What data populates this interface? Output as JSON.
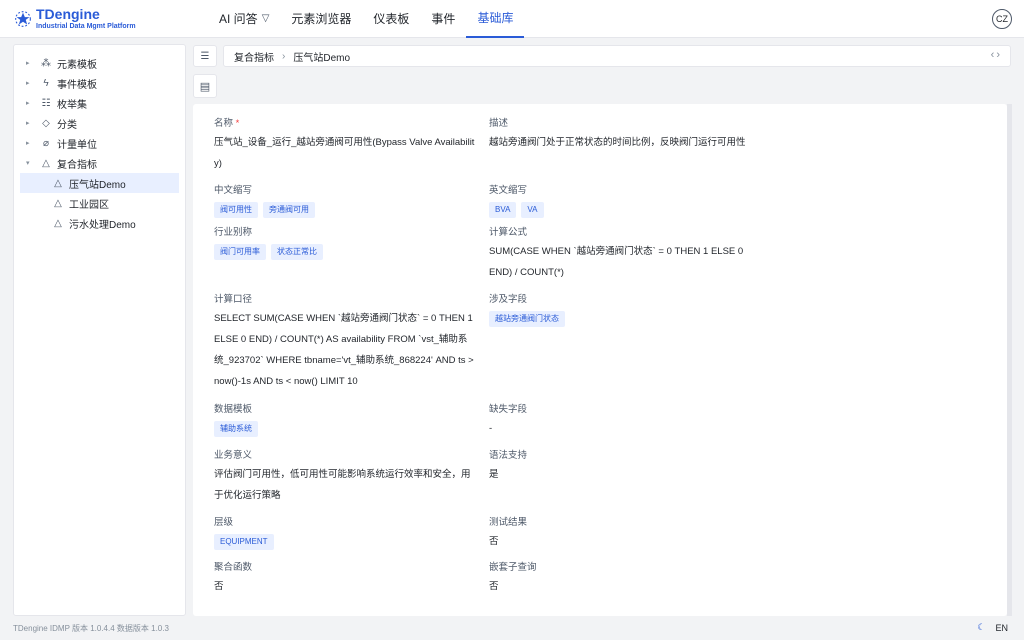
{
  "app": {
    "logo_title": "TDengine",
    "logo_subtitle": "Industrial Data Mgmt Platform",
    "avatar": "CZ"
  },
  "nav": {
    "items": [
      {
        "label": "AI 问答",
        "icon": "sparkle-icon"
      },
      {
        "label": "元素浏览器"
      },
      {
        "label": "仪表板"
      },
      {
        "label": "事件"
      },
      {
        "label": "基础库"
      }
    ],
    "active_index": 4
  },
  "sidebar": {
    "items": [
      {
        "label": "元素模板",
        "icon": "element-template-icon"
      },
      {
        "label": "事件模板",
        "icon": "lightning-icon"
      },
      {
        "label": "枚举集",
        "icon": "list-icon"
      },
      {
        "label": "分类",
        "icon": "tag-icon"
      },
      {
        "label": "计量单位",
        "icon": "ruler-icon"
      },
      {
        "label": "复合指标",
        "icon": "triangle-icon"
      }
    ],
    "children": [
      {
        "label": "压气站Demo",
        "selected": true
      },
      {
        "label": "工业园区"
      },
      {
        "label": "污水处理Demo"
      }
    ]
  },
  "breadcrumb": {
    "parent": "复合指标",
    "current": "压气站Demo"
  },
  "detail": {
    "name_label": "名称",
    "name_required_mark": "*",
    "name_value": "压气站_设备_运行_越站旁通阀可用性(Bypass Valve Availability)",
    "desc_label": "描述",
    "desc_value": "越站旁通阀门处于正常状态的时间比例，反映阀门运行可用性",
    "cn_abbr_label": "中文缩写",
    "cn_abbr_tags": [
      "阀可用性",
      "旁通阀可用"
    ],
    "en_abbr_label": "英文缩写",
    "en_abbr_tags": [
      "BVA",
      "VA"
    ],
    "alias_label": "行业别称",
    "alias_tags": [
      "阀门可用率",
      "状态正常比"
    ],
    "formula_label": "计算公式",
    "formula_value": "SUM(CASE WHEN `越站旁通阀门状态` = 0 THEN 1 ELSE 0 END) / COUNT(*)",
    "caliber_label": "计算口径",
    "caliber_value": "SELECT SUM(CASE WHEN `越站旁通阀门状态` = 0 THEN 1 ELSE 0 END) / COUNT(*) AS availability FROM `vst_辅助系统_923702` WHERE tbname='vt_辅助系统_868224' AND ts > now()-1s AND ts < now() LIMIT 10",
    "fields_label": "涉及字段",
    "fields_tags": [
      "越站旁通阀门状态"
    ],
    "template_label": "数据模板",
    "template_tags": [
      "辅助系统"
    ],
    "missing_label": "缺失字段",
    "missing_value": "-",
    "meaning_label": "业务意义",
    "meaning_value": "评估阀门可用性，低可用性可能影响系统运行效率和安全，用于优化运行策略",
    "syntax_label": "语法支持",
    "syntax_value": "是",
    "level_label": "层级",
    "level_tags": [
      "EQUIPMENT"
    ],
    "test_label": "测试结果",
    "test_value": "否",
    "agg_label": "聚合函数",
    "agg_value": "否",
    "nested_label": "嵌套子查询",
    "nested_value": "否"
  },
  "footer": {
    "version": "TDengine IDMP 版本 1.0.4.4 数据版本 1.0.3",
    "lang": "EN"
  },
  "colors": {
    "accent": "#2a5bd7",
    "tag_bg": "#e8efff"
  }
}
